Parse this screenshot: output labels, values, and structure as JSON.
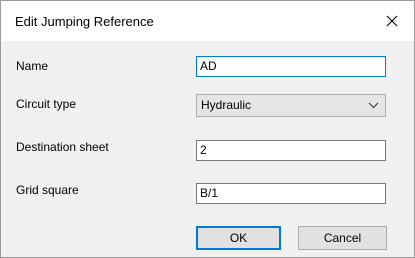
{
  "dialog": {
    "title": "Edit Jumping Reference",
    "close_icon": "close-icon"
  },
  "fields": {
    "name": {
      "label": "Name",
      "value": "AD"
    },
    "circuit_type": {
      "label": "Circuit type",
      "value": "Hydraulic",
      "icon": "chevron-down-icon"
    },
    "destination_sheet": {
      "label": "Destination sheet",
      "value": "2"
    },
    "grid_square": {
      "label": "Grid square",
      "value": "B/1"
    }
  },
  "buttons": {
    "ok": "OK",
    "cancel": "Cancel"
  }
}
